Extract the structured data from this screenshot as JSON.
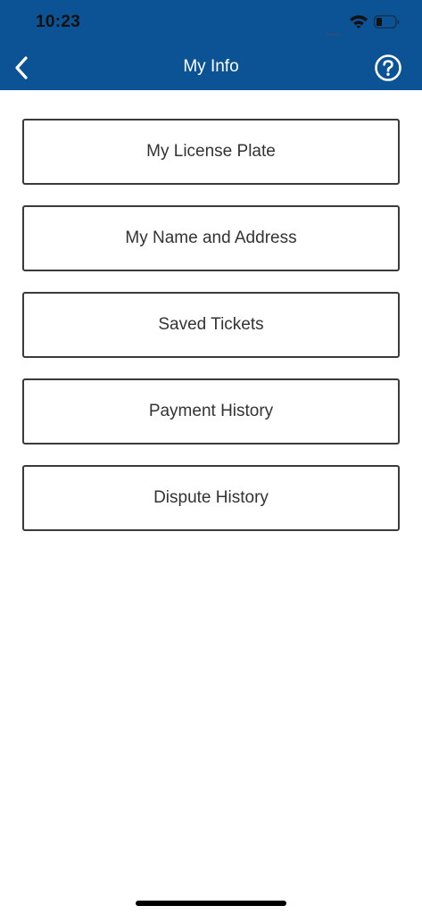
{
  "status_bar": {
    "time": "10:23",
    "icons": [
      "signal-icon",
      "wifi-icon",
      "battery-icon"
    ]
  },
  "nav": {
    "title": "My Info",
    "back_icon": "chevron-left-icon",
    "help_icon": "question-circle-icon"
  },
  "menu": {
    "items": [
      {
        "label": "My License Plate"
      },
      {
        "label": "My Name and Address"
      },
      {
        "label": "Saved Tickets"
      },
      {
        "label": "Payment History"
      },
      {
        "label": "Dispute History"
      }
    ]
  },
  "colors": {
    "header_bg": "#0b5394",
    "button_border": "#3a3a3c",
    "button_text": "#333333"
  }
}
